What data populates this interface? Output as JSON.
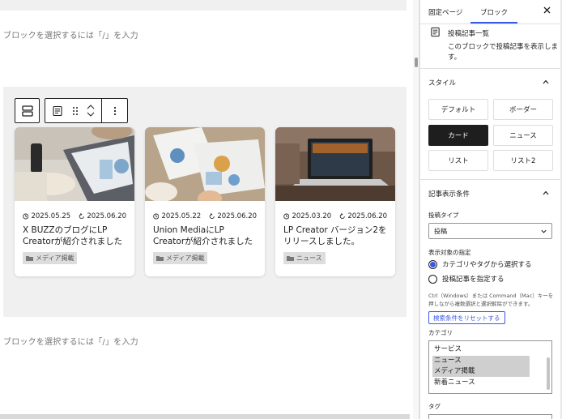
{
  "canvas": {
    "placeholder_top": "ブロックを選択するには「/」を入力",
    "placeholder_bottom": "ブロックを選択するには「/」を入力",
    "cards": [
      {
        "published": "2025.05.25",
        "updated": "2025.06.20",
        "title": "X BUZZのブログにLP Creatorが紹介されました",
        "category": "メディア掲載",
        "image": "laptop-charts-desk"
      },
      {
        "published": "2025.05.22",
        "updated": "2025.06.20",
        "title": "Union MediaにLP Creatorが紹介されました",
        "category": "メディア掲載",
        "image": "paper-charts-desk"
      },
      {
        "published": "2025.03.20",
        "updated": "2025.06.20",
        "title": "LP Creator バージョン2をリリースしました。",
        "category": "ニュース",
        "image": "laptop-on-table"
      }
    ]
  },
  "sidebar": {
    "tabs": [
      "固定ページ",
      "ブロック"
    ],
    "active_tab": "ブロック",
    "block": {
      "name": "投稿記事一覧",
      "description": "このブロックで投稿記事を表示します。"
    },
    "style_section": {
      "title": "スタイル",
      "options": [
        "デフォルト",
        "ボーダー",
        "カード",
        "ニュース",
        "リスト",
        "リスト2"
      ],
      "selected": "カード"
    },
    "conditions_section": {
      "title": "記事表示条件",
      "post_type_label": "投稿タイプ",
      "post_type_value": "投稿",
      "target_label": "表示対象の指定",
      "radio_options": [
        "カテゴリやタグから選択する",
        "投稿記事を指定する"
      ],
      "radio_selected": "カテゴリやタグから選択する",
      "hint": "Ctrl（Windows）または Command（Mac）キーを押しながら複数選択と選択解除ができます。",
      "reset_label": "検索条件をリセットする",
      "category_label": "カテゴリ",
      "categories": [
        "サービス",
        "ニュース",
        "メディア掲載",
        "新着ニュース"
      ],
      "categories_selected": [
        "ニュース",
        "メディア掲載"
      ],
      "tag_label": "タグ"
    }
  },
  "colors": {
    "accent": "#3858e9",
    "dark": "#1e1e1e",
    "canvas_gray": "#f0f0f0"
  }
}
